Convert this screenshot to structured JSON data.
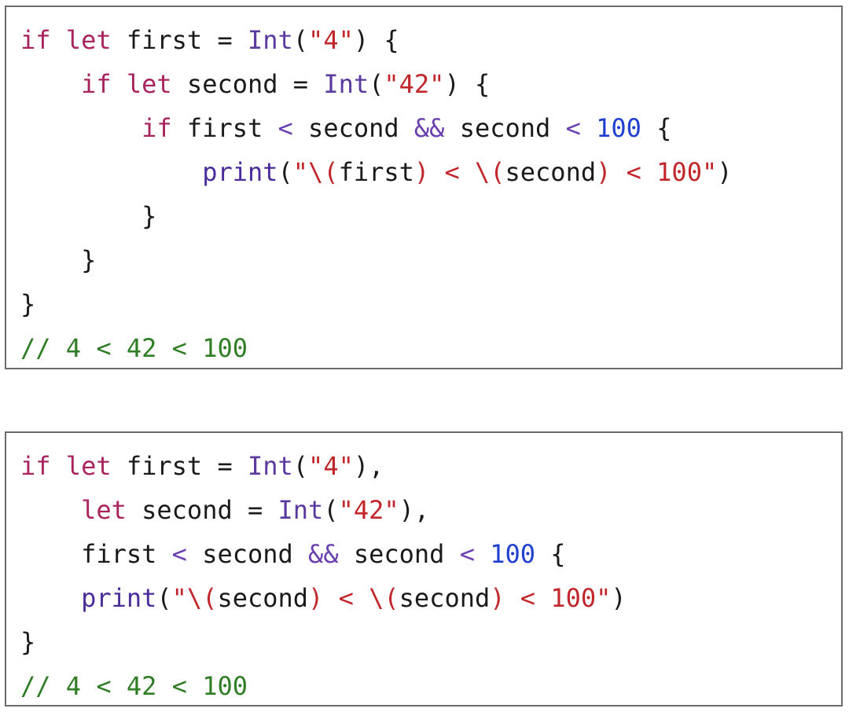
{
  "snippet1": {
    "l1": {
      "a": "if",
      "b": " ",
      "c": "let",
      "d": " first = ",
      "e": "Int",
      "f": "(",
      "g": "\"4\"",
      "h": ") {"
    },
    "l2": {
      "indent": "    ",
      "a": "if",
      "b": " ",
      "c": "let",
      "d": " second = ",
      "e": "Int",
      "f": "(",
      "g": "\"42\"",
      "h": ") {"
    },
    "l3": {
      "indent": "        ",
      "a": "if",
      "d": " first ",
      "op1": "<",
      "m": " second ",
      "amp": "&&",
      "n": " second ",
      "op2": "<",
      "s": " ",
      "num": "100",
      "h": " {"
    },
    "l4": {
      "indent": "            ",
      "fn": "print",
      "p": "(",
      "s1": "\"\\",
      "ip1": "(",
      "v1": "first",
      "ip2": ")",
      "s2": " < \\",
      "ip3": "(",
      "v2": "second",
      "ip4": ")",
      "s3": " < 100\"",
      "pe": ")"
    },
    "l5": {
      "text": "        }"
    },
    "l6": {
      "text": "    }"
    },
    "l7": {
      "text": "}"
    },
    "l8": {
      "comment": "// 4 < 42 < 100"
    }
  },
  "snippet2": {
    "l1": {
      "a": "if",
      "c": "let",
      "d": " first = ",
      "e": "Int",
      "f": "(",
      "g": "\"4\"",
      "h": "),"
    },
    "l2": {
      "indent": "    ",
      "c": "let",
      "d": " second = ",
      "e": "Int",
      "f": "(",
      "g": "\"42\"",
      "h": "),"
    },
    "l3": {
      "indent": "    ",
      "d": "first ",
      "op1": "<",
      "m": " second ",
      "amp": "&&",
      "n": " second ",
      "op2": "<",
      "s": " ",
      "num": "100",
      "h": " {"
    },
    "l4": {
      "indent": "    ",
      "fn": "print",
      "p": "(",
      "s1": "\"\\",
      "ip1": "(",
      "v1": "second",
      "ip2": ")",
      "s2": " < \\",
      "ip3": "(",
      "v2": "second",
      "ip4": ")",
      "s3": " < 100\"",
      "pe": ")"
    },
    "l5": {
      "text": "}"
    },
    "l6": {
      "comment": "// 4 < 42 < 100"
    }
  }
}
